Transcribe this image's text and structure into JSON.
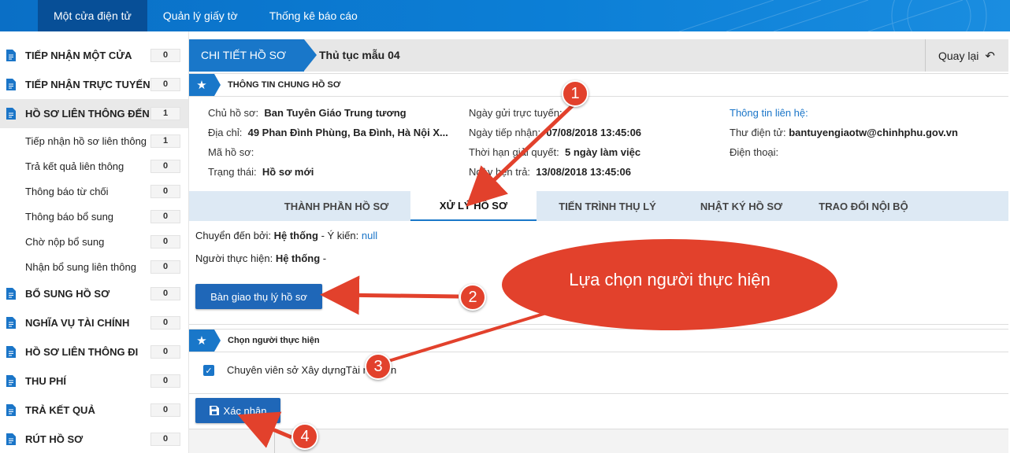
{
  "topnav": {
    "items": [
      "Một cửa điện tử",
      "Quản lý giấy tờ",
      "Thống kê báo cáo"
    ]
  },
  "sidebar": {
    "items": [
      {
        "label": "TIẾP NHẬN MỘT CỬA",
        "count": "0"
      },
      {
        "label": "TIẾP NHẬN TRỰC TUYẾN",
        "count": "0"
      },
      {
        "label": "HỒ SƠ LIÊN THÔNG ĐẾN",
        "count": "1"
      },
      {
        "label": "Tiếp nhận hồ sơ liên thông",
        "count": "1"
      },
      {
        "label": "Trả kết quả liên thông",
        "count": "0"
      },
      {
        "label": "Thông báo từ chối",
        "count": "0"
      },
      {
        "label": "Thông báo bổ sung",
        "count": "0"
      },
      {
        "label": "Chờ nộp bổ sung",
        "count": "0"
      },
      {
        "label": "Nhận bổ sung liên thông",
        "count": "0"
      },
      {
        "label": "BỔ SUNG HỒ SƠ",
        "count": "0"
      },
      {
        "label": "NGHĨA VỤ TÀI CHÍNH",
        "count": "0"
      },
      {
        "label": "HỒ SƠ LIÊN THÔNG ĐI",
        "count": "0"
      },
      {
        "label": "THU PHÍ",
        "count": "0"
      },
      {
        "label": "TRẢ KẾT QUẢ",
        "count": "0"
      },
      {
        "label": "RÚT HỒ SƠ",
        "count": "0"
      }
    ]
  },
  "header": {
    "crumb": "CHI TIẾT HỒ SƠ",
    "procedure": "Thủ tục mẫu 04",
    "back_label": "Quay lại"
  },
  "section_general": {
    "title": "THÔNG TIN CHUNG HỒ SƠ"
  },
  "info": {
    "col1": [
      {
        "label": "Chủ hồ sơ:",
        "value": "Ban Tuyên Giáo Trung tương"
      },
      {
        "label": "Địa chỉ:",
        "value": "49 Phan Đình Phùng, Ba Đình, Hà Nội X..."
      },
      {
        "label": "Mã hồ sơ:",
        "value": ""
      },
      {
        "label": "Trạng thái:",
        "value": "Hồ sơ mới"
      }
    ],
    "col2": [
      {
        "label": "Ngày gửi trực tuyến:",
        "value": ""
      },
      {
        "label": "Ngày tiếp nhận:",
        "value": "07/08/2018 13:45:06"
      },
      {
        "label": "Thời hạn giải quyết:",
        "value": "5 ngày làm việc"
      },
      {
        "label": "Ngày hẹn trả:",
        "value": "13/08/2018 13:45:06"
      }
    ],
    "col3": {
      "heading": "Thông tin liên hệ:",
      "email_label": "Thư điện tử:",
      "email_value": "bantuyengiaotw@chinhphu.gov.vn",
      "phone_label": "Điện thoại:"
    }
  },
  "tabs": [
    "THÀNH PHẦN HỒ SƠ",
    "XỬ LÝ HỒ SƠ",
    "TIẾN TRÌNH THỤ LÝ",
    "NHẬT KÝ HỒ SƠ",
    "TRAO ĐỔI NỘI BỘ"
  ],
  "processing": {
    "moved_by_label": "Chuyển đến bởi:",
    "moved_by_value": "Hệ thống",
    "opinion_label": "- Ý kiến:",
    "opinion_value": "null",
    "executor_label": "Người thực hiện:",
    "executor_value": "Hệ thống",
    "executor_suffix": "-",
    "handover_button": "Bàn giao thụ lý hồ sơ"
  },
  "section_choose": {
    "title": "Chọn người thực hiện"
  },
  "choose": {
    "option_label": "Chuyên viên sở Xây dựngTài nguyên",
    "confirm_button": "Xác nhận"
  },
  "annotations": {
    "callout": "Lựa chọn người thực hiện",
    "steps": [
      "1",
      "2",
      "3",
      "4"
    ],
    "color": "#e2412c"
  }
}
